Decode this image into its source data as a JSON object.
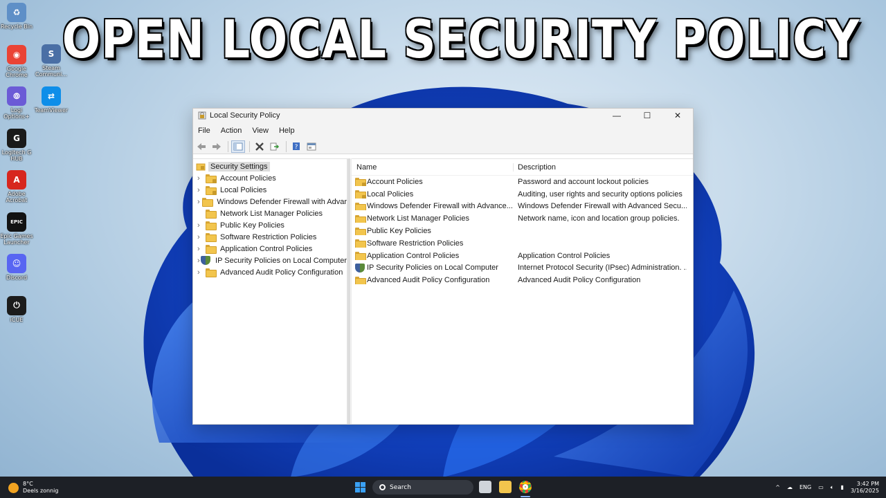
{
  "headline": "OPEN LOCAL SECURITY POLICY",
  "desktop_icons": [
    {
      "label": "Recycle Bin",
      "color": "#5e8fc7",
      "glyph": "♻",
      "icon": "recycle-bin-icon"
    },
    {
      "label": "Google Chrome",
      "color": "#ea4335",
      "glyph": "◉",
      "icon": "chrome-icon"
    },
    {
      "label": "Logi Options+",
      "color": "#6b5bd6",
      "glyph": "⦾",
      "icon": "logi-options-icon"
    },
    {
      "label": "Logitech G HUB",
      "color": "#1a1a1a",
      "glyph": "G",
      "icon": "logitech-ghub-icon"
    },
    {
      "label": "Adobe Acrobat",
      "color": "#d7261e",
      "glyph": "A",
      "icon": "acrobat-icon"
    },
    {
      "label": "Epic Games Launcher",
      "color": "#121212",
      "glyph": "EPIC",
      "icon": "epic-games-icon"
    },
    {
      "label": "Discord",
      "color": "#5865f2",
      "glyph": "☺",
      "icon": "discord-icon"
    },
    {
      "label": "iCUE",
      "color": "#1c1c1c",
      "glyph": "⏻",
      "icon": "icue-icon"
    }
  ],
  "desktop_icons_col2": [
    {
      "label": "Steam Communi...",
      "color": "#4a6fa5",
      "glyph": "S",
      "icon": "steam-icon"
    },
    {
      "label": "TeamViewer",
      "color": "#0e8ee9",
      "glyph": "⇄",
      "icon": "teamviewer-icon"
    }
  ],
  "window": {
    "title": "Local Security Policy",
    "controls": {
      "minimize": "—",
      "maximize": "☐",
      "close": "✕"
    },
    "menu": [
      "File",
      "Action",
      "View",
      "Help"
    ],
    "tree_root": "Security Settings",
    "tree": [
      {
        "label": "Account Policies",
        "expandable": true,
        "icon": "folder-lock"
      },
      {
        "label": "Local Policies",
        "expandable": true,
        "icon": "folder-lock"
      },
      {
        "label": "Windows Defender Firewall with Advar",
        "expandable": true,
        "icon": "folder"
      },
      {
        "label": "Network List Manager Policies",
        "expandable": false,
        "icon": "folder"
      },
      {
        "label": "Public Key Policies",
        "expandable": true,
        "icon": "folder"
      },
      {
        "label": "Software Restriction Policies",
        "expandable": true,
        "icon": "folder"
      },
      {
        "label": "Application Control Policies",
        "expandable": true,
        "icon": "folder"
      },
      {
        "label": "IP Security Policies on Local Computer",
        "expandable": true,
        "icon": "shield"
      },
      {
        "label": "Advanced Audit Policy Configuration",
        "expandable": true,
        "icon": "folder"
      }
    ],
    "columns": {
      "name": "Name",
      "description": "Description"
    },
    "rows": [
      {
        "name": "Account Policies",
        "description": "Password and account lockout policies",
        "icon": "folder-lock"
      },
      {
        "name": "Local Policies",
        "description": "Auditing, user rights and security options policies",
        "icon": "folder-lock"
      },
      {
        "name": "Windows Defender Firewall with Advance...",
        "description": "Windows Defender Firewall with Advanced Secu...",
        "icon": "folder"
      },
      {
        "name": "Network List Manager Policies",
        "description": "Network name, icon and location group policies.",
        "icon": "folder"
      },
      {
        "name": "Public Key Policies",
        "description": "",
        "icon": "folder"
      },
      {
        "name": "Software Restriction Policies",
        "description": "",
        "icon": "folder"
      },
      {
        "name": "Application Control Policies",
        "description": "Application Control Policies",
        "icon": "folder"
      },
      {
        "name": "IP Security Policies on Local Computer",
        "description": "Internet Protocol Security (IPsec) Administration. ...",
        "icon": "shield"
      },
      {
        "name": "Advanced Audit Policy Configuration",
        "description": "Advanced Audit Policy Configuration",
        "icon": "folder"
      }
    ]
  },
  "taskbar": {
    "weather_temp": "8°C",
    "weather_desc": "Deels zonnig",
    "search_label": "Search",
    "language": "ENG",
    "time": "3:42 PM",
    "date": "3/16/2025"
  }
}
